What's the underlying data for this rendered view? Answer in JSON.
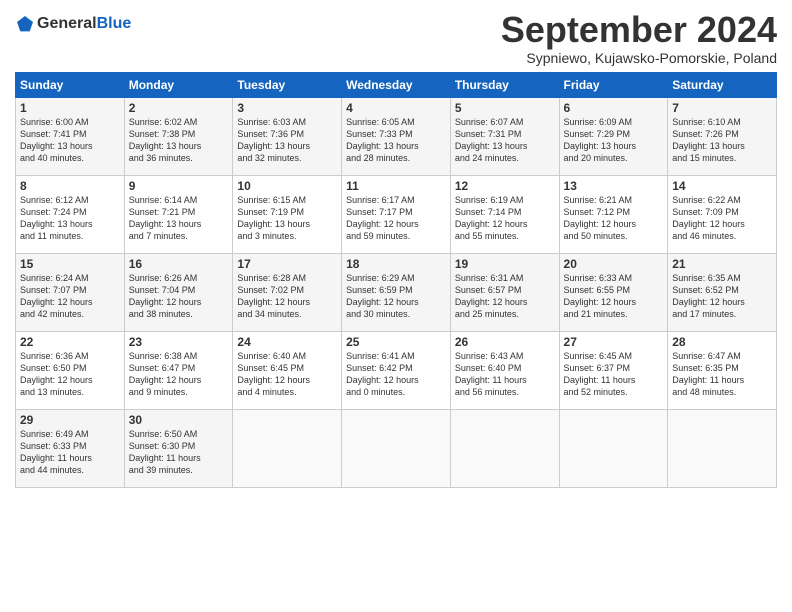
{
  "header": {
    "logo_line1": "General",
    "logo_line2": "Blue",
    "month": "September 2024",
    "location": "Sypniewo, Kujawsko-Pomorskie, Poland"
  },
  "weekdays": [
    "Sunday",
    "Monday",
    "Tuesday",
    "Wednesday",
    "Thursday",
    "Friday",
    "Saturday"
  ],
  "weeks": [
    [
      {
        "day": "1",
        "info": "Sunrise: 6:00 AM\nSunset: 7:41 PM\nDaylight: 13 hours\nand 40 minutes."
      },
      {
        "day": "2",
        "info": "Sunrise: 6:02 AM\nSunset: 7:38 PM\nDaylight: 13 hours\nand 36 minutes."
      },
      {
        "day": "3",
        "info": "Sunrise: 6:03 AM\nSunset: 7:36 PM\nDaylight: 13 hours\nand 32 minutes."
      },
      {
        "day": "4",
        "info": "Sunrise: 6:05 AM\nSunset: 7:33 PM\nDaylight: 13 hours\nand 28 minutes."
      },
      {
        "day": "5",
        "info": "Sunrise: 6:07 AM\nSunset: 7:31 PM\nDaylight: 13 hours\nand 24 minutes."
      },
      {
        "day": "6",
        "info": "Sunrise: 6:09 AM\nSunset: 7:29 PM\nDaylight: 13 hours\nand 20 minutes."
      },
      {
        "day": "7",
        "info": "Sunrise: 6:10 AM\nSunset: 7:26 PM\nDaylight: 13 hours\nand 15 minutes."
      }
    ],
    [
      {
        "day": "8",
        "info": "Sunrise: 6:12 AM\nSunset: 7:24 PM\nDaylight: 13 hours\nand 11 minutes."
      },
      {
        "day": "9",
        "info": "Sunrise: 6:14 AM\nSunset: 7:21 PM\nDaylight: 13 hours\nand 7 minutes."
      },
      {
        "day": "10",
        "info": "Sunrise: 6:15 AM\nSunset: 7:19 PM\nDaylight: 13 hours\nand 3 minutes."
      },
      {
        "day": "11",
        "info": "Sunrise: 6:17 AM\nSunset: 7:17 PM\nDaylight: 12 hours\nand 59 minutes."
      },
      {
        "day": "12",
        "info": "Sunrise: 6:19 AM\nSunset: 7:14 PM\nDaylight: 12 hours\nand 55 minutes."
      },
      {
        "day": "13",
        "info": "Sunrise: 6:21 AM\nSunset: 7:12 PM\nDaylight: 12 hours\nand 50 minutes."
      },
      {
        "day": "14",
        "info": "Sunrise: 6:22 AM\nSunset: 7:09 PM\nDaylight: 12 hours\nand 46 minutes."
      }
    ],
    [
      {
        "day": "15",
        "info": "Sunrise: 6:24 AM\nSunset: 7:07 PM\nDaylight: 12 hours\nand 42 minutes."
      },
      {
        "day": "16",
        "info": "Sunrise: 6:26 AM\nSunset: 7:04 PM\nDaylight: 12 hours\nand 38 minutes."
      },
      {
        "day": "17",
        "info": "Sunrise: 6:28 AM\nSunset: 7:02 PM\nDaylight: 12 hours\nand 34 minutes."
      },
      {
        "day": "18",
        "info": "Sunrise: 6:29 AM\nSunset: 6:59 PM\nDaylight: 12 hours\nand 30 minutes."
      },
      {
        "day": "19",
        "info": "Sunrise: 6:31 AM\nSunset: 6:57 PM\nDaylight: 12 hours\nand 25 minutes."
      },
      {
        "day": "20",
        "info": "Sunrise: 6:33 AM\nSunset: 6:55 PM\nDaylight: 12 hours\nand 21 minutes."
      },
      {
        "day": "21",
        "info": "Sunrise: 6:35 AM\nSunset: 6:52 PM\nDaylight: 12 hours\nand 17 minutes."
      }
    ],
    [
      {
        "day": "22",
        "info": "Sunrise: 6:36 AM\nSunset: 6:50 PM\nDaylight: 12 hours\nand 13 minutes."
      },
      {
        "day": "23",
        "info": "Sunrise: 6:38 AM\nSunset: 6:47 PM\nDaylight: 12 hours\nand 9 minutes."
      },
      {
        "day": "24",
        "info": "Sunrise: 6:40 AM\nSunset: 6:45 PM\nDaylight: 12 hours\nand 4 minutes."
      },
      {
        "day": "25",
        "info": "Sunrise: 6:41 AM\nSunset: 6:42 PM\nDaylight: 12 hours\nand 0 minutes."
      },
      {
        "day": "26",
        "info": "Sunrise: 6:43 AM\nSunset: 6:40 PM\nDaylight: 11 hours\nand 56 minutes."
      },
      {
        "day": "27",
        "info": "Sunrise: 6:45 AM\nSunset: 6:37 PM\nDaylight: 11 hours\nand 52 minutes."
      },
      {
        "day": "28",
        "info": "Sunrise: 6:47 AM\nSunset: 6:35 PM\nDaylight: 11 hours\nand 48 minutes."
      }
    ],
    [
      {
        "day": "29",
        "info": "Sunrise: 6:49 AM\nSunset: 6:33 PM\nDaylight: 11 hours\nand 44 minutes."
      },
      {
        "day": "30",
        "info": "Sunrise: 6:50 AM\nSunset: 6:30 PM\nDaylight: 11 hours\nand 39 minutes."
      },
      {
        "day": "",
        "info": ""
      },
      {
        "day": "",
        "info": ""
      },
      {
        "day": "",
        "info": ""
      },
      {
        "day": "",
        "info": ""
      },
      {
        "day": "",
        "info": ""
      }
    ]
  ]
}
